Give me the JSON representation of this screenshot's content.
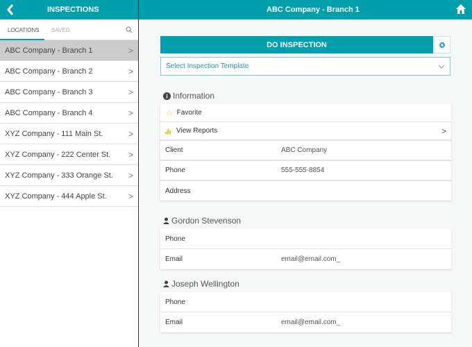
{
  "header": {
    "left_title": "INSPECTIONS",
    "title": "ABC Company - Branch 1"
  },
  "sidebar": {
    "tabs": [
      "LOCATIONS",
      "SAVED"
    ],
    "items": [
      "ABC Company - Branch 1",
      "ABC Company - Branch 2",
      "ABC Company - Branch 3",
      "ABC Company - Branch 4",
      "XYZ Company - 111 Main St.",
      "XYZ Company - 222 Center St.",
      "XYZ Company - 333 Orange St.",
      "XYZ Company - 444 Apple St."
    ],
    "chevron": ">"
  },
  "main": {
    "do_inspection": "DO INSPECTION",
    "template_placeholder": "Select Inspection Template",
    "info": {
      "heading": "Information",
      "favorite": "Favorite",
      "view_reports": "View Reports",
      "chevron": ">",
      "fields": [
        {
          "label": "Client",
          "value": "ABC Company"
        },
        {
          "label": "Phone",
          "value": "555-555-8854"
        },
        {
          "label": "Address",
          "value": ""
        }
      ]
    },
    "contacts": [
      {
        "name": "Gordon Stevenson",
        "fields": [
          {
            "label": "Phone",
            "value": ""
          },
          {
            "label": "Email",
            "value": "email@email.com_"
          }
        ]
      },
      {
        "name": "Joseph Wellington",
        "fields": [
          {
            "label": "Phone",
            "value": ""
          },
          {
            "label": "Email",
            "value": "email@email.com_"
          }
        ]
      }
    ]
  },
  "colors": {
    "accent": "#02a0ad"
  }
}
